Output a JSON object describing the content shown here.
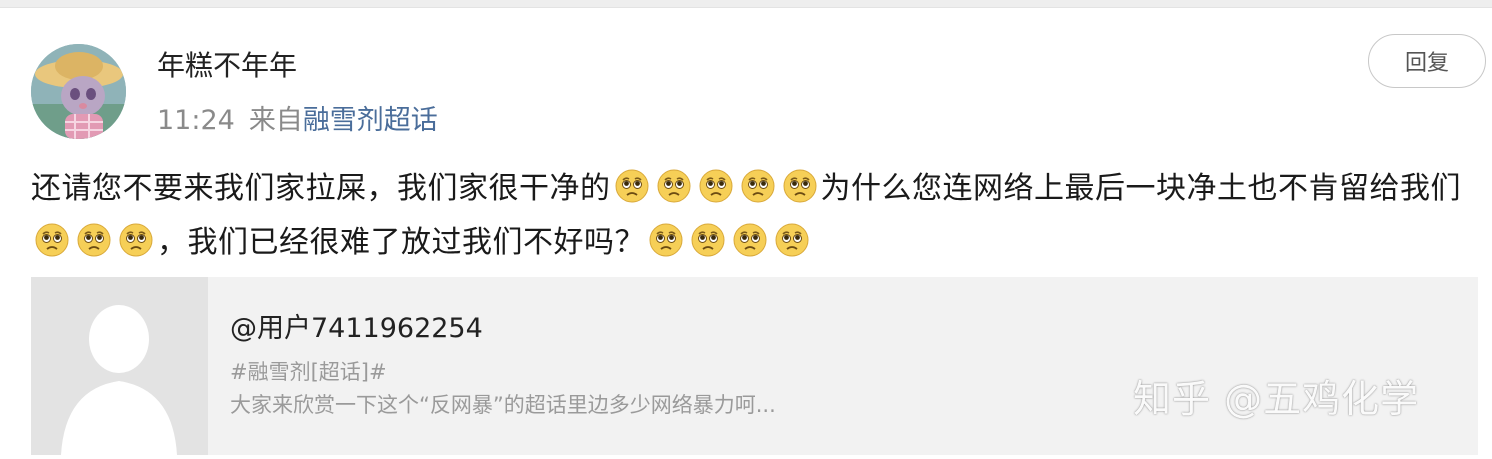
{
  "post": {
    "username": "年糕不年年",
    "time": "11:24",
    "source_prefix": "来自",
    "source_link": "融雪剂超话",
    "reply_button": "回复",
    "avatar_icon": "cartoon-rabbit-avatar",
    "content": {
      "part1": "还请您不要来我们家拉屎，我们家很干净的",
      "part2": "为什么您连网络上最后一块净土也不肯留给我们",
      "part3": "，我们已经很难了放过我们不好吗？",
      "emoji_name": "pitiful-face-emoji"
    }
  },
  "repost_card": {
    "title": "@用户7411962254",
    "tag": "#融雪剂[超话]#",
    "description": "大家来欣赏一下这个“反网暴”的超话里边多少网络暴力呵...",
    "thumbnail_icon": "default-user-silhouette-icon"
  },
  "watermark": "知乎 @五鸡化学",
  "colors": {
    "link": "#4a6d9a",
    "meta_text": "#8a8a8a",
    "card_bg": "#f2f2f2",
    "emoji_face": "#f6cf57"
  }
}
